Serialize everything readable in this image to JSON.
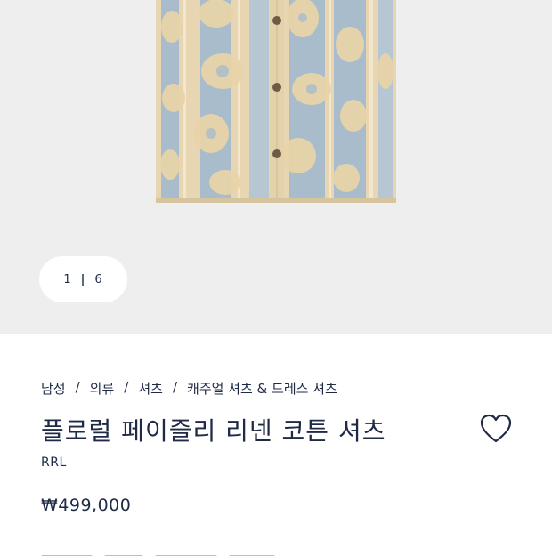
{
  "gallery": {
    "image_alt": "paisley floral shirt",
    "pager": {
      "current": "1",
      "separator": "|",
      "total": "6"
    }
  },
  "breadcrumb": {
    "items": [
      "남성",
      "의류",
      "셔츠",
      "캐주얼 셔츠 & 드레스 셔츠"
    ],
    "separator": "/"
  },
  "product": {
    "title": "플로럴 페이즐리 리넨 코튼 셔츠",
    "brand": "RRL",
    "price": "₩499,000"
  },
  "icons": {
    "wishlist": "heart-outline-icon"
  },
  "colors": {
    "background_gallery": "#eeeeee",
    "text": "#1f2a44",
    "shirt_blue": "#a9bccc",
    "shirt_cream": "#e8d6b2"
  }
}
